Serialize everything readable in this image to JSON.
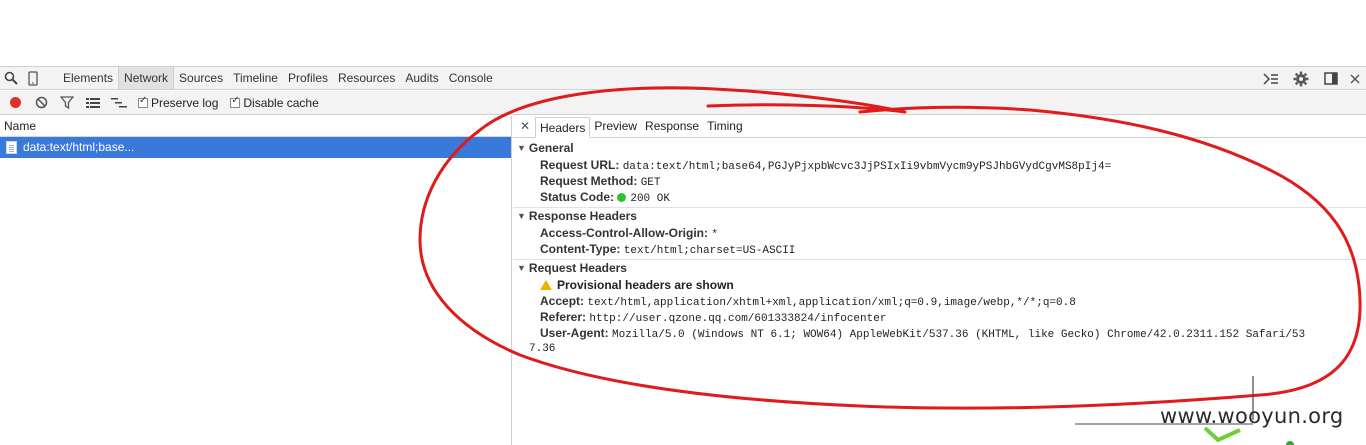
{
  "toolbar": {
    "tabs": [
      {
        "label": "Elements"
      },
      {
        "label": "Network"
      },
      {
        "label": "Sources"
      },
      {
        "label": "Timeline"
      },
      {
        "label": "Profiles"
      },
      {
        "label": "Resources"
      },
      {
        "label": "Audits"
      },
      {
        "label": "Console"
      }
    ],
    "active_tab": "Network"
  },
  "network_toolbar": {
    "preserve_log_label": "Preserve log",
    "preserve_log_checked": true,
    "disable_cache_label": "Disable cache",
    "disable_cache_checked": true
  },
  "request_list": {
    "column_header": "Name",
    "items": [
      {
        "name": "data:text/html;base..."
      }
    ]
  },
  "detail": {
    "tabs": [
      "Headers",
      "Preview",
      "Response",
      "Timing"
    ],
    "active_tab": "Headers",
    "general": {
      "title": "General",
      "request_url_key": "Request URL:",
      "request_url": "data:text/html;base64,PGJyPjxpbWcvc3JjPSIxIi9vbmVycm9yPSJhbGVydCgvMS8pIj4=",
      "request_method_key": "Request Method:",
      "request_method": "GET",
      "status_code_key": "Status Code:",
      "status_code": "200 OK"
    },
    "response_headers": {
      "title": "Response Headers",
      "acao_key": "Access-Control-Allow-Origin:",
      "acao": "*",
      "content_type_key": "Content-Type:",
      "content_type": "text/html;charset=US-ASCII"
    },
    "request_headers": {
      "title": "Request Headers",
      "warning": "Provisional headers are shown",
      "accept_key": "Accept:",
      "accept": "text/html,application/xhtml+xml,application/xml;q=0.9,image/webp,*/*;q=0.8",
      "referer_key": "Referer:",
      "referer": "http://user.qzone.qq.com/601333824/infocenter",
      "user_agent_key": "User-Agent:",
      "user_agent_line1": "Mozilla/5.0 (Windows NT 6.1; WOW64) AppleWebKit/537.36 (KHTML, like Gecko) Chrome/42.0.2311.152 Safari/53",
      "user_agent_line2": "7.36"
    }
  },
  "watermark": "www.wooyun.org",
  "colors": {
    "selection": "#3879d9",
    "annotation": "#e01b1b",
    "record": "#e0302a",
    "status_ok": "#2fbf2f"
  }
}
